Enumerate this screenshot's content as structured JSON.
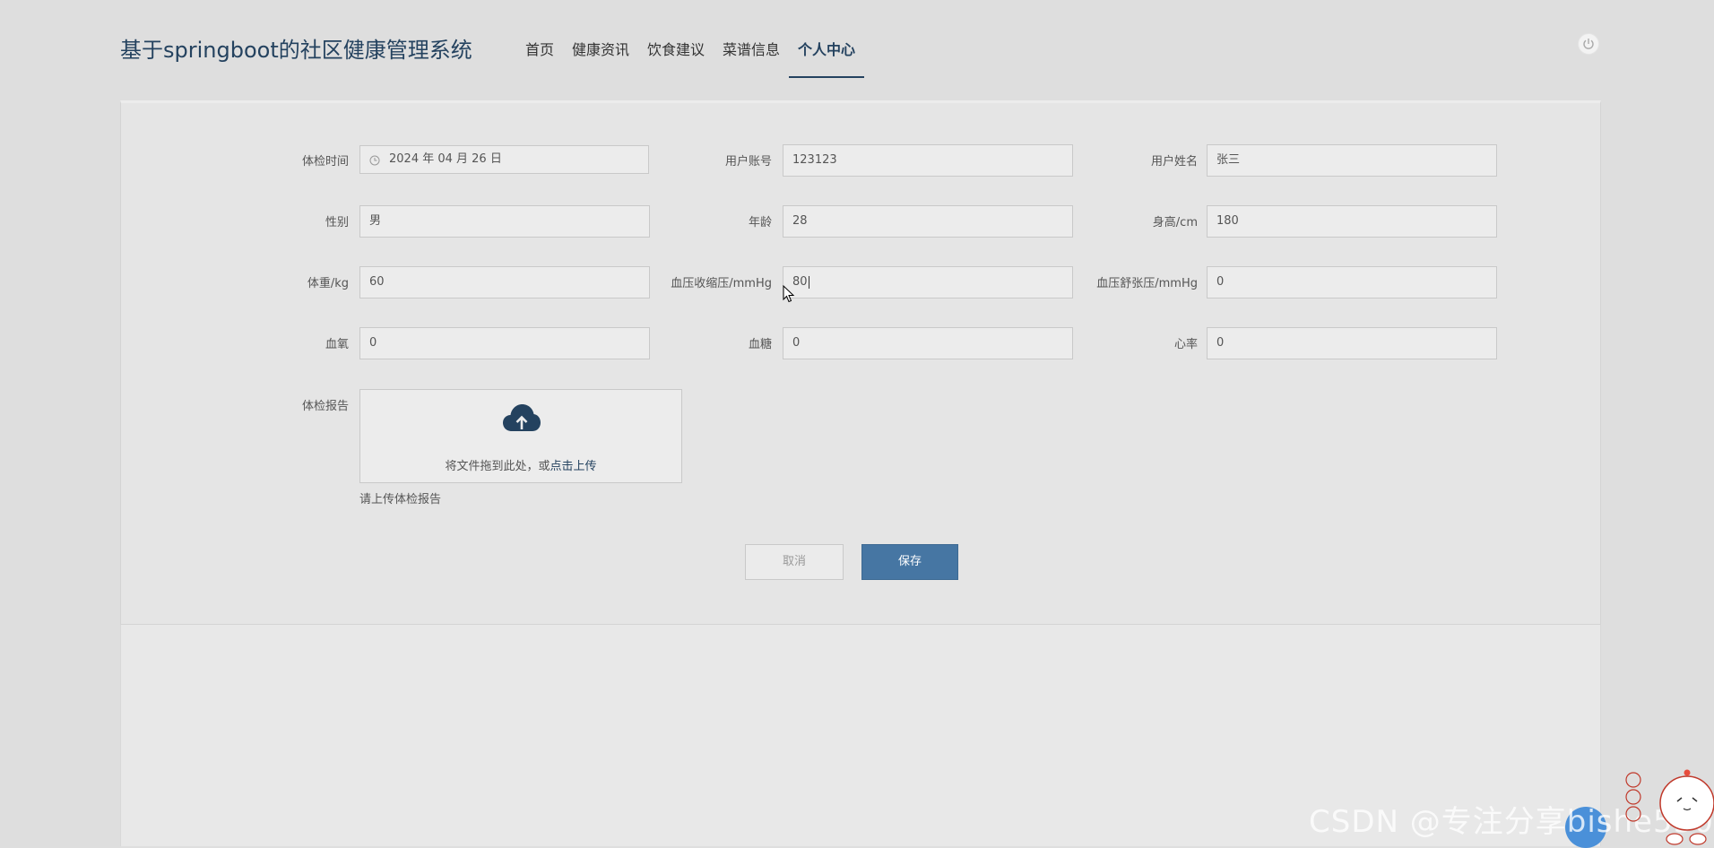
{
  "app": {
    "title": "基于springboot的社区健康管理系统"
  },
  "nav": {
    "items": [
      {
        "label": "首页"
      },
      {
        "label": "健康资讯"
      },
      {
        "label": "饮食建议"
      },
      {
        "label": "菜谱信息"
      },
      {
        "label": "个人中心",
        "active": true
      }
    ]
  },
  "form": {
    "exam_time": {
      "label": "体检时间",
      "value": "2024 年 04 月 26 日"
    },
    "account": {
      "label": "用户账号",
      "value": "123123"
    },
    "name": {
      "label": "用户姓名",
      "value": "张三"
    },
    "gender": {
      "label": "性别",
      "value": "男"
    },
    "age": {
      "label": "年龄",
      "value": "28"
    },
    "height": {
      "label": "身高/cm",
      "value": "180"
    },
    "weight": {
      "label": "体重/kg",
      "value": "60"
    },
    "systolic": {
      "label": "血压收缩压/mmHg",
      "value": "80"
    },
    "diastolic": {
      "label": "血压舒张压/mmHg",
      "value": "0"
    },
    "oxygen": {
      "label": "血氧",
      "value": "0"
    },
    "glucose": {
      "label": "血糖",
      "value": "0"
    },
    "heart_rate": {
      "label": "心率",
      "value": "0"
    },
    "report": {
      "label": "体检报告",
      "drop_text": "将文件拖到此处，或",
      "link_text": "点击上传",
      "tip": "请上传体检报告"
    }
  },
  "buttons": {
    "cancel": "取消",
    "save": "保存"
  },
  "icons": {
    "power": "power-icon",
    "clock": "clock-icon",
    "upload": "cloud-upload-icon",
    "cursor": "mouse-cursor-icon"
  },
  "colors": {
    "accent": "#24425f",
    "primary_button": "#4676a3"
  },
  "watermark": {
    "text": "CSDN @专注分享bishe530"
  }
}
